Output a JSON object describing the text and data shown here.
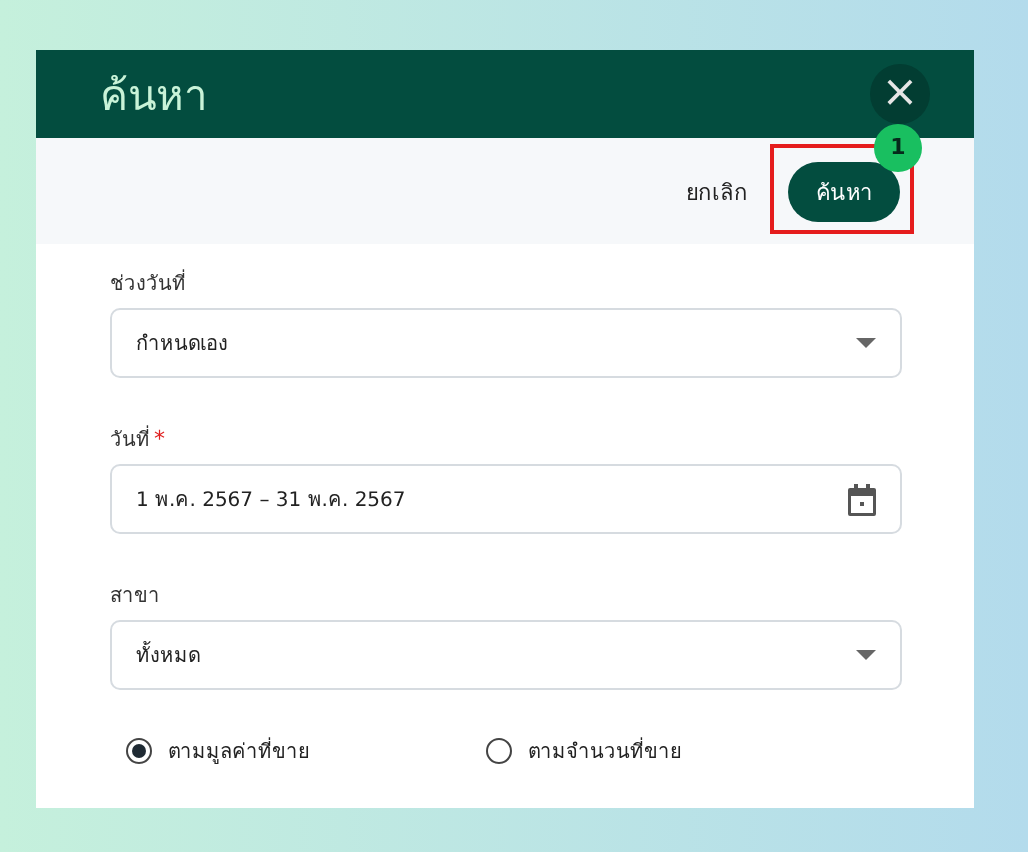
{
  "dialog": {
    "title": "ค้นหา",
    "close_icon": "×"
  },
  "actions": {
    "cancel": "ยกเลิก",
    "search": "ค้นหา",
    "annotation": {
      "label": "1"
    }
  },
  "fields": [
    {
      "kind": "select",
      "label": "ช่วงวันที่",
      "value": "กำหนดเอง"
    },
    {
      "kind": "date",
      "label": "วันที่",
      "required_mark": "*",
      "value": "1 พ.ค. 2567 – 31 พ.ค. 2567"
    },
    {
      "kind": "select",
      "label": "สาขา",
      "value": "ทั้งหมด"
    }
  ],
  "radios": [
    {
      "label": "ตามมูลค่าที่ขาย",
      "selected": true
    },
    {
      "label": "ตามจำนวนที่ขาย",
      "selected": false
    }
  ]
}
